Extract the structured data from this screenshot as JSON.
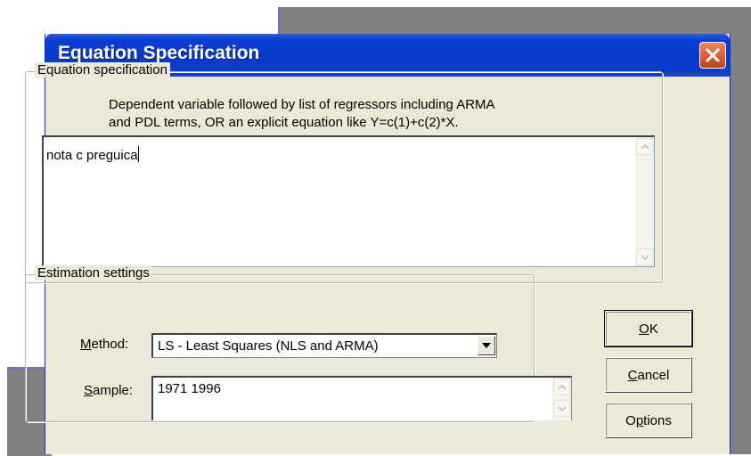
{
  "window": {
    "title": "Equation Specification"
  },
  "spec": {
    "legend": "Equation specification",
    "hint_line1": "Dependent variable followed by list of regressors including ARMA",
    "hint_line2": "and PDL terms, OR an explicit equation like Y=c(1)+c(2)*X.",
    "equation_value": "nota c preguica"
  },
  "estimation": {
    "legend": "Estimation settings",
    "method_label": "Method:",
    "method_value": "LS  -  Least Squares (NLS and ARMA)",
    "sample_label": "Sample:",
    "sample_value": "1971 1996"
  },
  "buttons": {
    "ok": "OK",
    "cancel": "Cancel",
    "options": "Options"
  },
  "icons": {
    "close": "close-icon",
    "scroll_up": "scroll-up-arrow-icon",
    "scroll_down": "scroll-down-arrow-icon",
    "dropdown": "dropdown-arrow-icon"
  },
  "colors": {
    "titlebar": "#0a3acb",
    "dialog_bg": "#ece9d8",
    "close_button": "#d55a2f"
  }
}
